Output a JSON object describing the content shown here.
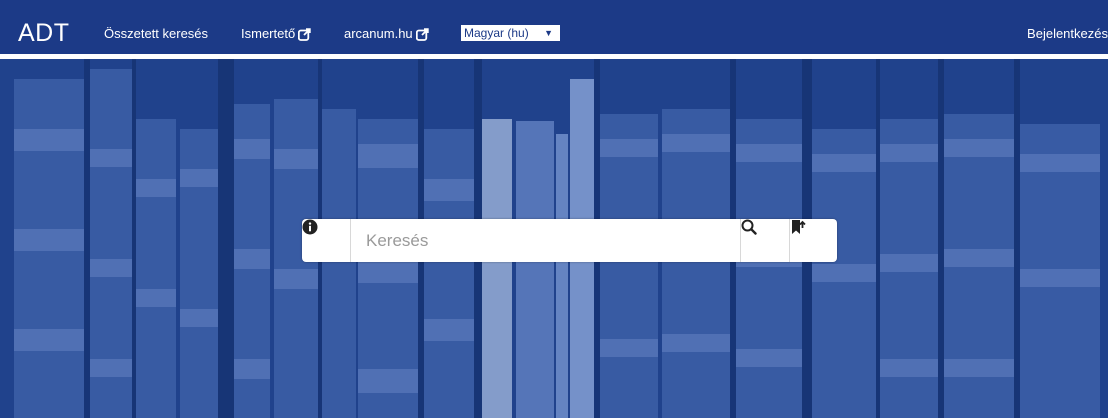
{
  "header": {
    "logo": "ADT",
    "nav": {
      "advanced_search": "Összetett keresés",
      "about": "Ismertető",
      "arcanum": "arcanum.hu"
    },
    "language": {
      "selected": "Magyar (hu)"
    },
    "login": "Bejelentkezés"
  },
  "search": {
    "placeholder": "Keresés",
    "value": ""
  },
  "icons": {
    "info": "info-circle-icon",
    "search": "search-icon",
    "save": "bookmark-save-icon",
    "external": "external-link-icon"
  },
  "colors": {
    "brand": "#1c3a87",
    "hero": "#20428c",
    "white": "#ffffff"
  }
}
